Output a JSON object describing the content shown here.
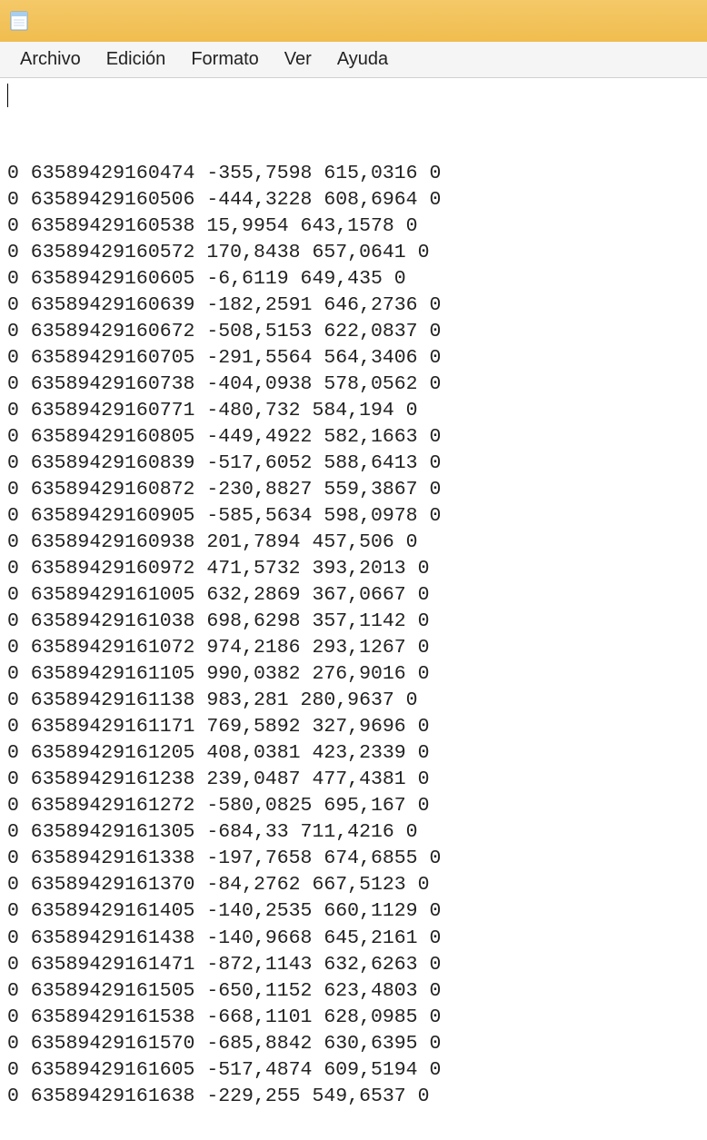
{
  "menubar": {
    "items": [
      {
        "label": "Archivo"
      },
      {
        "label": "Edición"
      },
      {
        "label": "Formato"
      },
      {
        "label": "Ver"
      },
      {
        "label": "Ayuda"
      }
    ]
  },
  "content": {
    "lines": [
      "0 63589429160474 -355,7598 615,0316 0",
      "0 63589429160506 -444,3228 608,6964 0",
      "0 63589429160538 15,9954 643,1578 0",
      "0 63589429160572 170,8438 657,0641 0",
      "0 63589429160605 -6,6119 649,435 0",
      "0 63589429160639 -182,2591 646,2736 0",
      "0 63589429160672 -508,5153 622,0837 0",
      "0 63589429160705 -291,5564 564,3406 0",
      "0 63589429160738 -404,0938 578,0562 0",
      "0 63589429160771 -480,732 584,194 0",
      "0 63589429160805 -449,4922 582,1663 0",
      "0 63589429160839 -517,6052 588,6413 0",
      "0 63589429160872 -230,8827 559,3867 0",
      "0 63589429160905 -585,5634 598,0978 0",
      "0 63589429160938 201,7894 457,506 0",
      "0 63589429160972 471,5732 393,2013 0",
      "0 63589429161005 632,2869 367,0667 0",
      "0 63589429161038 698,6298 357,1142 0",
      "0 63589429161072 974,2186 293,1267 0",
      "0 63589429161105 990,0382 276,9016 0",
      "0 63589429161138 983,281 280,9637 0",
      "0 63589429161171 769,5892 327,9696 0",
      "0 63589429161205 408,0381 423,2339 0",
      "0 63589429161238 239,0487 477,4381 0",
      "0 63589429161272 -580,0825 695,167 0",
      "0 63589429161305 -684,33 711,4216 0",
      "0 63589429161338 -197,7658 674,6855 0",
      "0 63589429161370 -84,2762 667,5123 0",
      "0 63589429161405 -140,2535 660,1129 0",
      "0 63589429161438 -140,9668 645,2161 0",
      "0 63589429161471 -872,1143 632,6263 0",
      "0 63589429161505 -650,1152 623,4803 0",
      "0 63589429161538 -668,1101 628,0985 0",
      "0 63589429161570 -685,8842 630,6395 0",
      "0 63589429161605 -517,4874 609,5194 0",
      "0 63589429161638 -229,255 549,6537 0"
    ]
  }
}
